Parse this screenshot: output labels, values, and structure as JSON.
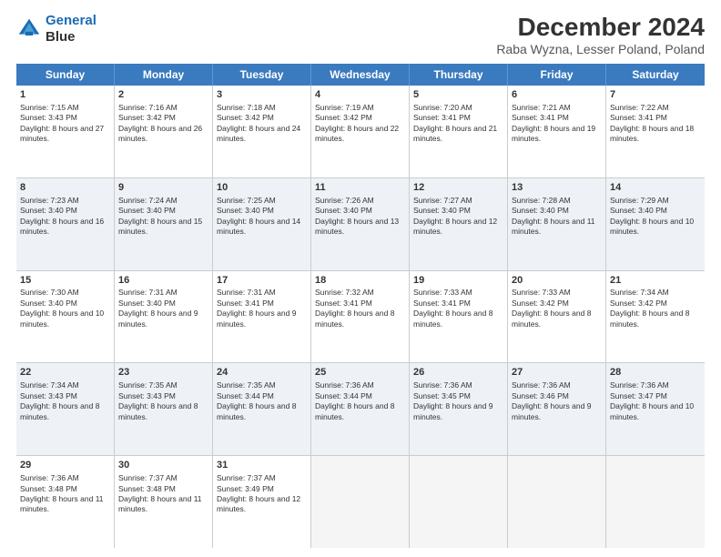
{
  "logo": {
    "line1": "General",
    "line2": "Blue"
  },
  "title": "December 2024",
  "subtitle": "Raba Wyzna, Lesser Poland, Poland",
  "days": [
    "Sunday",
    "Monday",
    "Tuesday",
    "Wednesday",
    "Thursday",
    "Friday",
    "Saturday"
  ],
  "weeks": [
    [
      {
        "day": 1,
        "sunrise": "7:15 AM",
        "sunset": "3:43 PM",
        "daylight": "8 hours and 27 minutes."
      },
      {
        "day": 2,
        "sunrise": "7:16 AM",
        "sunset": "3:42 PM",
        "daylight": "8 hours and 26 minutes."
      },
      {
        "day": 3,
        "sunrise": "7:18 AM",
        "sunset": "3:42 PM",
        "daylight": "8 hours and 24 minutes."
      },
      {
        "day": 4,
        "sunrise": "7:19 AM",
        "sunset": "3:42 PM",
        "daylight": "8 hours and 22 minutes."
      },
      {
        "day": 5,
        "sunrise": "7:20 AM",
        "sunset": "3:41 PM",
        "daylight": "8 hours and 21 minutes."
      },
      {
        "day": 6,
        "sunrise": "7:21 AM",
        "sunset": "3:41 PM",
        "daylight": "8 hours and 19 minutes."
      },
      {
        "day": 7,
        "sunrise": "7:22 AM",
        "sunset": "3:41 PM",
        "daylight": "8 hours and 18 minutes."
      }
    ],
    [
      {
        "day": 8,
        "sunrise": "7:23 AM",
        "sunset": "3:40 PM",
        "daylight": "8 hours and 16 minutes."
      },
      {
        "day": 9,
        "sunrise": "7:24 AM",
        "sunset": "3:40 PM",
        "daylight": "8 hours and 15 minutes."
      },
      {
        "day": 10,
        "sunrise": "7:25 AM",
        "sunset": "3:40 PM",
        "daylight": "8 hours and 14 minutes."
      },
      {
        "day": 11,
        "sunrise": "7:26 AM",
        "sunset": "3:40 PM",
        "daylight": "8 hours and 13 minutes."
      },
      {
        "day": 12,
        "sunrise": "7:27 AM",
        "sunset": "3:40 PM",
        "daylight": "8 hours and 12 minutes."
      },
      {
        "day": 13,
        "sunrise": "7:28 AM",
        "sunset": "3:40 PM",
        "daylight": "8 hours and 11 minutes."
      },
      {
        "day": 14,
        "sunrise": "7:29 AM",
        "sunset": "3:40 PM",
        "daylight": "8 hours and 10 minutes."
      }
    ],
    [
      {
        "day": 15,
        "sunrise": "7:30 AM",
        "sunset": "3:40 PM",
        "daylight": "8 hours and 10 minutes."
      },
      {
        "day": 16,
        "sunrise": "7:31 AM",
        "sunset": "3:40 PM",
        "daylight": "8 hours and 9 minutes."
      },
      {
        "day": 17,
        "sunrise": "7:31 AM",
        "sunset": "3:41 PM",
        "daylight": "8 hours and 9 minutes."
      },
      {
        "day": 18,
        "sunrise": "7:32 AM",
        "sunset": "3:41 PM",
        "daylight": "8 hours and 8 minutes."
      },
      {
        "day": 19,
        "sunrise": "7:33 AM",
        "sunset": "3:41 PM",
        "daylight": "8 hours and 8 minutes."
      },
      {
        "day": 20,
        "sunrise": "7:33 AM",
        "sunset": "3:42 PM",
        "daylight": "8 hours and 8 minutes."
      },
      {
        "day": 21,
        "sunrise": "7:34 AM",
        "sunset": "3:42 PM",
        "daylight": "8 hours and 8 minutes."
      }
    ],
    [
      {
        "day": 22,
        "sunrise": "7:34 AM",
        "sunset": "3:43 PM",
        "daylight": "8 hours and 8 minutes."
      },
      {
        "day": 23,
        "sunrise": "7:35 AM",
        "sunset": "3:43 PM",
        "daylight": "8 hours and 8 minutes."
      },
      {
        "day": 24,
        "sunrise": "7:35 AM",
        "sunset": "3:44 PM",
        "daylight": "8 hours and 8 minutes."
      },
      {
        "day": 25,
        "sunrise": "7:36 AM",
        "sunset": "3:44 PM",
        "daylight": "8 hours and 8 minutes."
      },
      {
        "day": 26,
        "sunrise": "7:36 AM",
        "sunset": "3:45 PM",
        "daylight": "8 hours and 9 minutes."
      },
      {
        "day": 27,
        "sunrise": "7:36 AM",
        "sunset": "3:46 PM",
        "daylight": "8 hours and 9 minutes."
      },
      {
        "day": 28,
        "sunrise": "7:36 AM",
        "sunset": "3:47 PM",
        "daylight": "8 hours and 10 minutes."
      }
    ],
    [
      {
        "day": 29,
        "sunrise": "7:36 AM",
        "sunset": "3:48 PM",
        "daylight": "8 hours and 11 minutes."
      },
      {
        "day": 30,
        "sunrise": "7:37 AM",
        "sunset": "3:48 PM",
        "daylight": "8 hours and 11 minutes."
      },
      {
        "day": 31,
        "sunrise": "7:37 AM",
        "sunset": "3:49 PM",
        "daylight": "8 hours and 12 minutes."
      },
      null,
      null,
      null,
      null
    ]
  ]
}
